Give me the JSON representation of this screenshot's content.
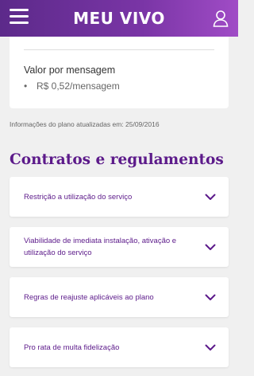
{
  "header": {
    "logo_text": "MEU VIVO",
    "menu_icon": "hamburger-menu-icon",
    "user_icon": "user-icon"
  },
  "plan_card": {
    "label": "Valor por mensagem",
    "value": "R$ 0,52/mensagem"
  },
  "updated_text": "Informações do plano atualizadas em: 25/09/2016",
  "contracts": {
    "title": "Contratos e regulamentos",
    "items": [
      {
        "label": "Restrição a utilização do serviço"
      },
      {
        "label": "Viabilidade de imediata instalação, ativação e utilização do serviço"
      },
      {
        "label": "Regras de reajuste aplicáveis ao plano"
      },
      {
        "label": "Pro rata de multa fidelização"
      }
    ]
  },
  "colors": {
    "brand_purple": "#5c1a8a",
    "header_gradient_start": "#5c2a8a",
    "header_gradient_end": "#a04cc6",
    "background": "#f0f0f0"
  }
}
